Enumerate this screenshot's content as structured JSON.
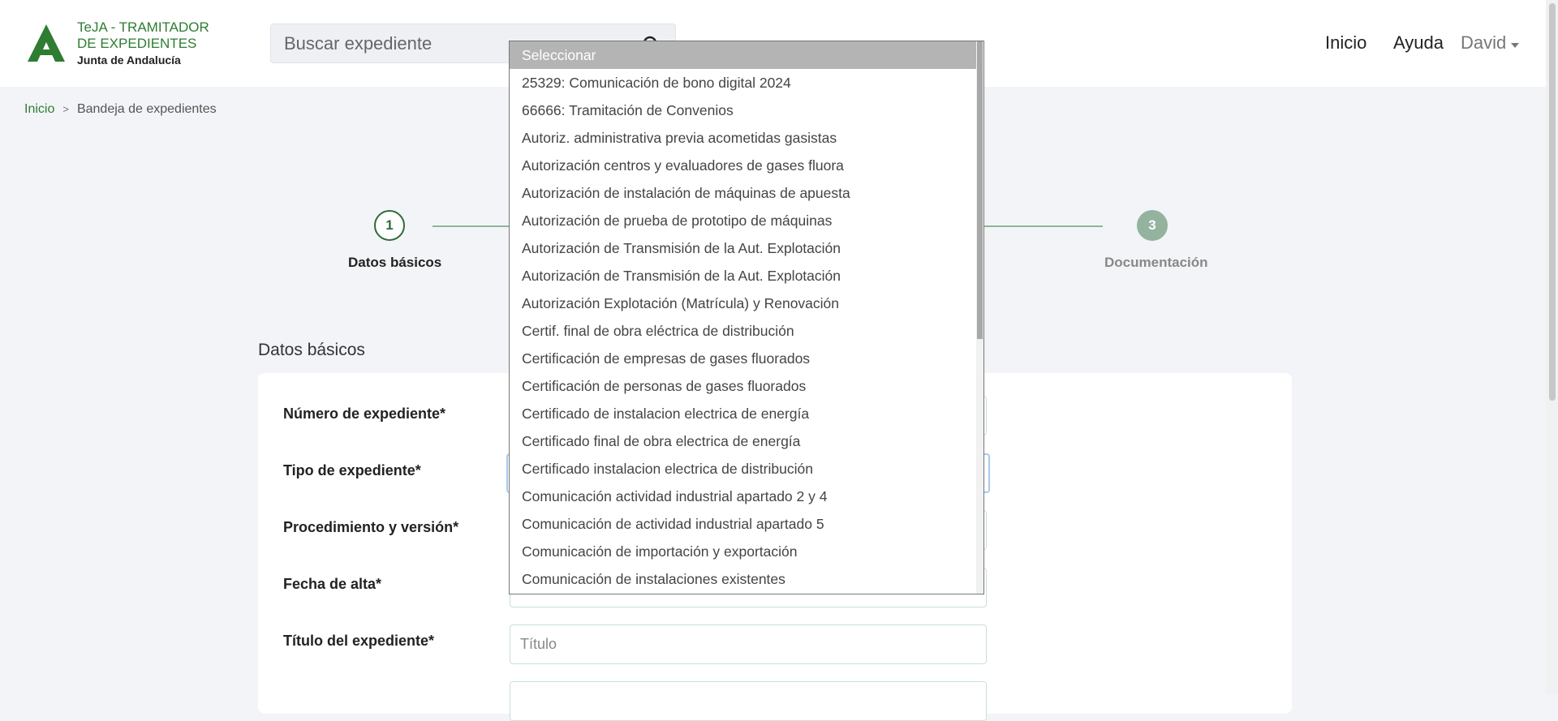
{
  "header": {
    "logo_title": "TeJA - TRAMITADOR DE EXPEDIENTES",
    "logo_subtitle": "Junta de Andalucía",
    "search_placeholder": "Buscar expediente",
    "nav": {
      "home": "Inicio",
      "help": "Ayuda",
      "user": "David"
    }
  },
  "breadcrumb": {
    "home": "Inicio",
    "separator": ">",
    "current": "Bandeja de expedientes"
  },
  "stepper": {
    "step1": {
      "number": "1",
      "label": "Datos básicos"
    },
    "step3": {
      "number": "3",
      "label": "Documentación"
    }
  },
  "section_title": "Datos básicos",
  "form": {
    "numero_label": "Número de expediente*",
    "tipo_label": "Tipo de expediente*",
    "procedimiento_label": "Procedimiento y versión*",
    "fecha_label": "Fecha de alta*",
    "titulo_label": "Título del expediente*",
    "titulo_placeholder": "Título"
  },
  "dropdown": {
    "options": [
      "Seleccionar",
      "25329: Comunicación de bono digital 2024",
      "66666: Tramitación de Convenios",
      "Autoriz. administrativa previa acometidas gasistas",
      "Autorización centros y evaluadores de gases fluora",
      "Autorización de instalación de máquinas de apuesta",
      "Autorización de prueba de prototipo de máquinas",
      "Autorización de Transmisión de la Aut. Explotación",
      "Autorización de Transmisión de la Aut. Explotación",
      "Autorización Explotación (Matrícula) y Renovación",
      "Certif. final de obra eléctrica de distribución",
      "Certificación de empresas de gases fluorados",
      "Certificación de personas de gases fluorados",
      "Certificado de instalacion electrica de energía",
      "Certificado final de obra electrica de energía",
      "Certificado instalacion electrica de distribución",
      "Comunicación actividad industrial apartado 2 y 4",
      "Comunicación de actividad industrial apartado 5",
      "Comunicación de importación y exportación",
      "Comunicación de instalaciones existentes"
    ],
    "selected_index": 0
  },
  "colors": {
    "brand": "#2e7d32",
    "background": "#f3f4f7",
    "selected_option": "#b4b4b4"
  }
}
